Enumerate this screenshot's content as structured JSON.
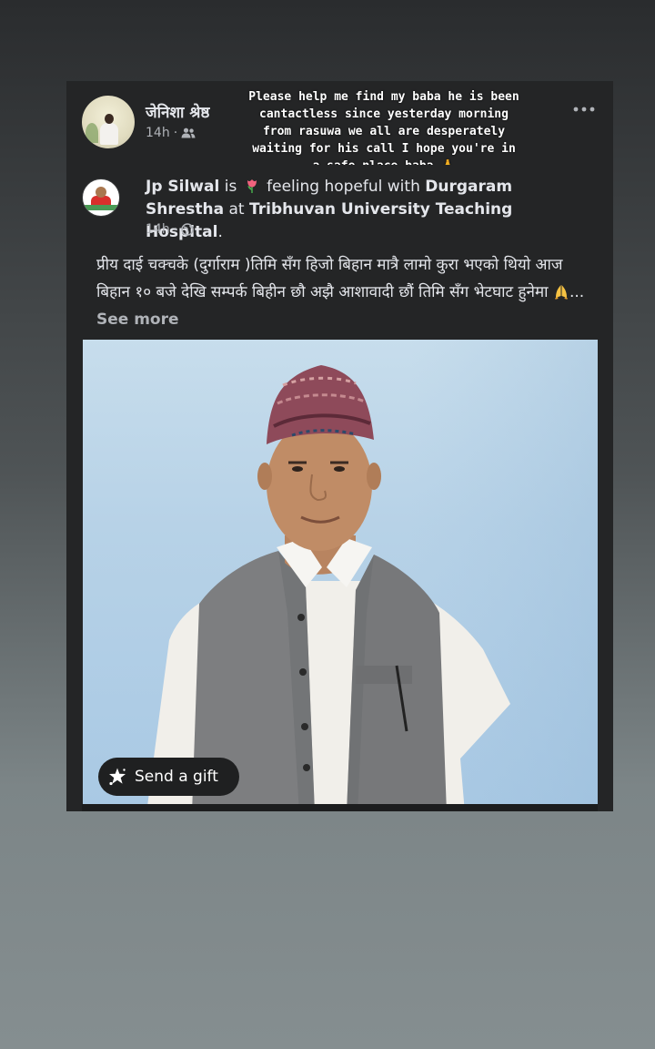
{
  "story": {
    "author_name": "जेनिशा श्रेष्ठ",
    "time": "14h",
    "audience_icon": "friends-icon",
    "overlay_text": "Please help me find my baba he is been cantactless since yesterday morning from rasuwa we all are desperately waiting for his call I hope you're in a safe place baba 🙏",
    "more_icon": "more-icon"
  },
  "post": {
    "author": "Jp Silwal",
    "is": "is",
    "feeling": "feeling hopeful with",
    "tagged": "Durgaram Shrestha",
    "at": "at",
    "place": "Tribhuvan University Teaching Hospital",
    "period": ".",
    "time": "14h",
    "audience_icon": "globe-icon",
    "body": "प्रीय दाई चक्चके (दुर्गाराम )तिमि सँग हिजो बिहान मात्रै लामो कुरा भएको थियो आज बिहान १० बजे देखि सम्पर्क बिहीन छौ अझै आशावादी छौं तिमि सँग भेटघाट हुनेमा",
    "ellipsis": "...",
    "see_more": "See more",
    "gift_label": "Send a gift"
  },
  "colors": {
    "card_bg": "#242526",
    "text_primary": "#e4e6eb",
    "text_secondary": "#b0b3b8",
    "photo_wall": "#b7d2e7"
  }
}
